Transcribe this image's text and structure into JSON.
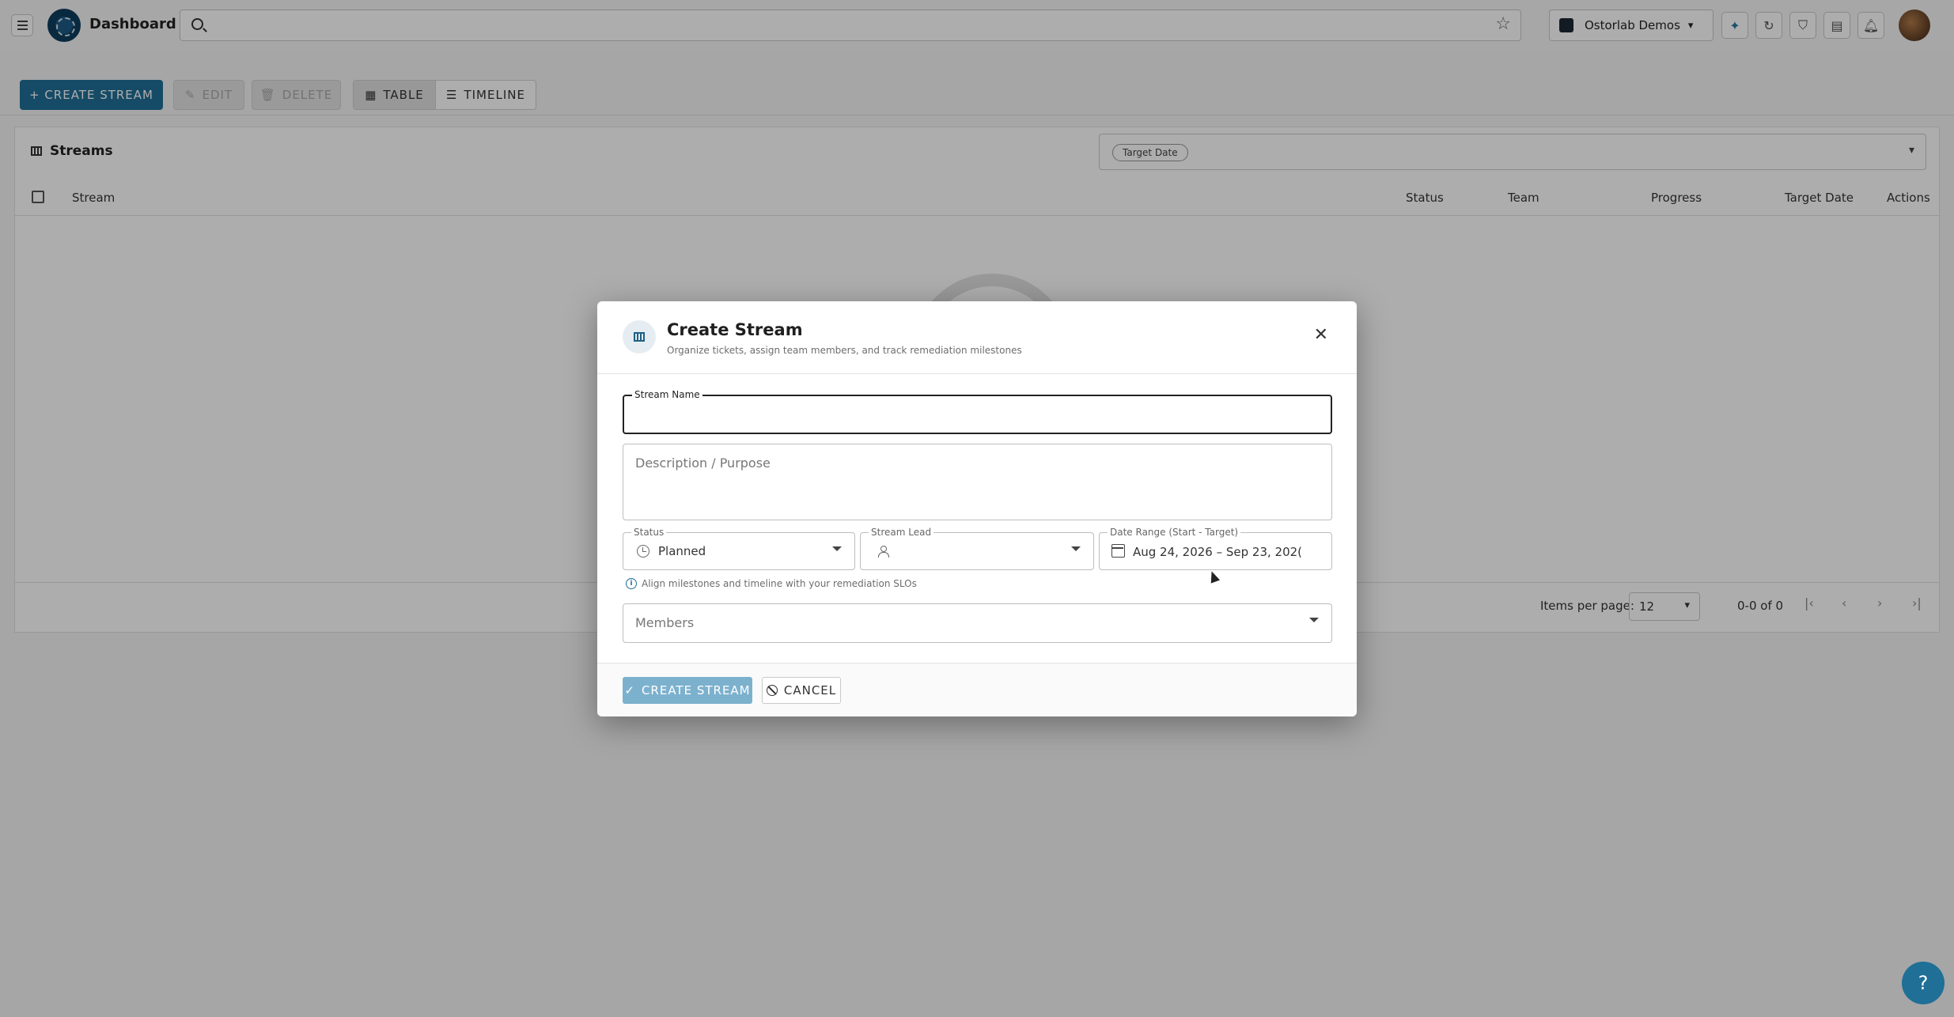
{
  "app": {
    "title": "Dashboard"
  },
  "topbar": {
    "org_name": "Ostorlab Demos"
  },
  "toolbar": {
    "create_label": "+ CREATE STREAM",
    "edit_label": "EDIT",
    "delete_label": "DELETE",
    "view_table": "TABLE",
    "view_timeline": "TIMELINE"
  },
  "streams": {
    "title": "Streams",
    "filter_chip": "Target Date",
    "columns": [
      "Stream",
      "Status",
      "Team",
      "Progress",
      "Target Date",
      "Actions"
    ]
  },
  "pagination": {
    "items_per_page_label": "Items per page:",
    "items_per_page": "12",
    "range": "0-0 of 0"
  },
  "dialog": {
    "title": "Create Stream",
    "subtitle": "Organize tickets, assign team members, and track remediation milestones",
    "stream_name_label": "Stream Name",
    "stream_name_value": "",
    "description_placeholder": "Description / Purpose",
    "status_label": "Status",
    "status_value": "Planned",
    "lead_label": "Stream Lead",
    "lead_value": "",
    "date_label": "Date Range (Start - Target)",
    "date_value": "Aug 24, 2026 – Sep 23, 202(",
    "hint": "Align milestones and timeline with your remediation SLOs",
    "members_placeholder": "Members",
    "create_button": "CREATE STREAM",
    "cancel_button": "CANCEL"
  },
  "help_label": "?",
  "colors": {
    "primary": "#1f6f97",
    "primary_disabled": "#7cb1ce"
  }
}
